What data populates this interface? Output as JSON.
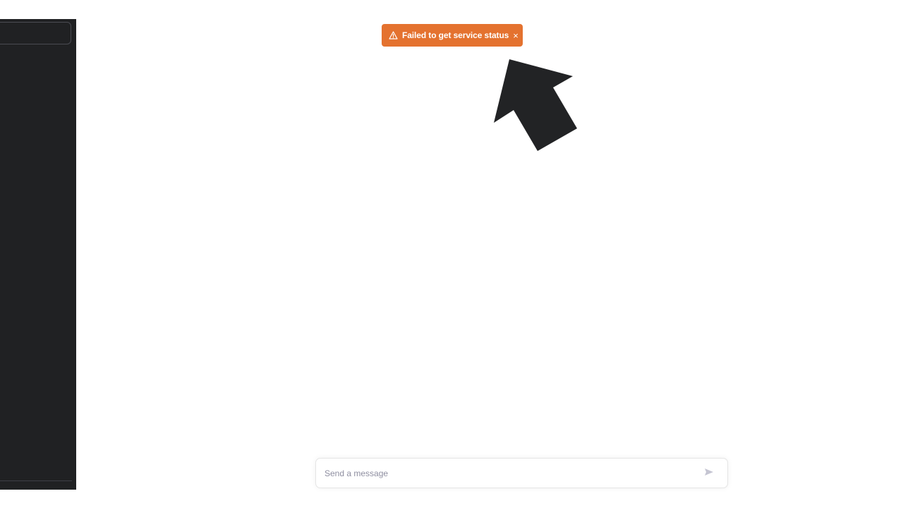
{
  "toast": {
    "icon": "warning-triangle-icon",
    "message": "Failed to get service status",
    "close_glyph": "×",
    "background_color": "#e4722f"
  },
  "sidebar": {
    "background_color": "#202123"
  },
  "composer": {
    "placeholder": "Send a message",
    "value": "",
    "send_icon": "send-icon"
  },
  "annotation": {
    "icon": "arrow-pointer-icon",
    "color": "#222325"
  }
}
